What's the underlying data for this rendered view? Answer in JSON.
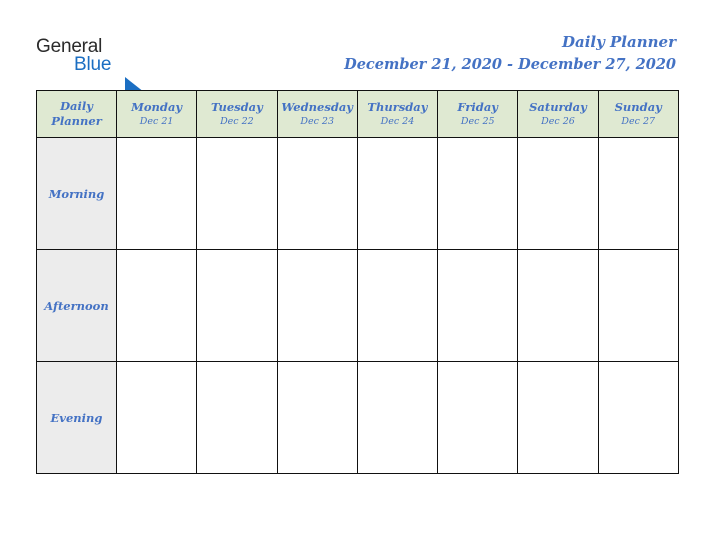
{
  "brand": {
    "word_one": "General",
    "word_two": "Blue",
    "triangle_icon": "triangle-icon",
    "word_one_color": "#2b2b2b",
    "word_two_color": "#1b6ec2"
  },
  "header": {
    "title": "Daily Planner",
    "date_range": "December 21, 2020 - December 27, 2020",
    "title_color": "#4472c4"
  },
  "colors": {
    "header_cell_background": "#dfe9d2",
    "slot_label_background": "#ececec",
    "cell_background": "#ffffff",
    "border": "#111111",
    "accent_text": "#4472c4",
    "page_background": "#ffffff"
  },
  "table": {
    "corner_label_line1": "Daily",
    "corner_label_line2": "Planner",
    "columns": [
      {
        "day": "Monday",
        "date": "Dec 21"
      },
      {
        "day": "Tuesday",
        "date": "Dec 22"
      },
      {
        "day": "Wednesday",
        "date": "Dec 23"
      },
      {
        "day": "Thursday",
        "date": "Dec 24"
      },
      {
        "day": "Friday",
        "date": "Dec 25"
      },
      {
        "day": "Saturday",
        "date": "Dec 26"
      },
      {
        "day": "Sunday",
        "date": "Dec 27"
      }
    ],
    "rows": [
      {
        "label": "Morning",
        "cells": [
          "",
          "",
          "",
          "",
          "",
          "",
          ""
        ]
      },
      {
        "label": "Afternoon",
        "cells": [
          "",
          "",
          "",
          "",
          "",
          "",
          ""
        ]
      },
      {
        "label": "Evening",
        "cells": [
          "",
          "",
          "",
          "",
          "",
          "",
          ""
        ]
      }
    ]
  }
}
